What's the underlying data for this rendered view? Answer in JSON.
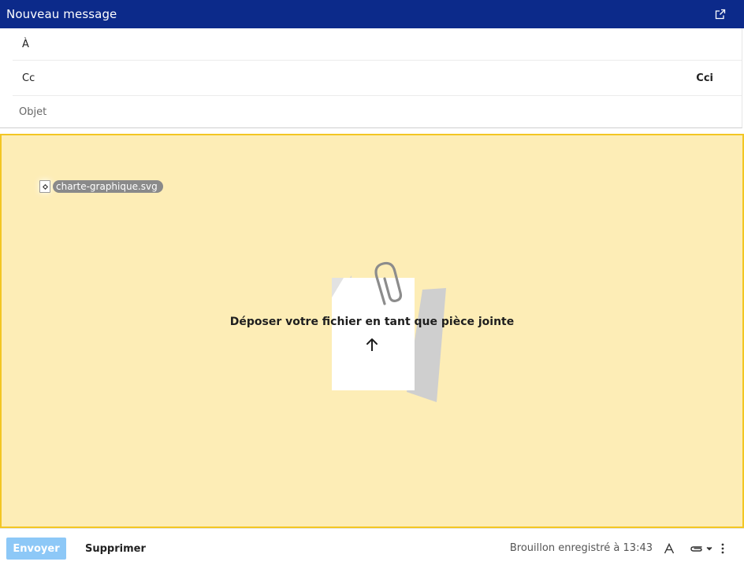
{
  "header": {
    "title": "Nouveau message",
    "popout_icon": "external-window-icon"
  },
  "fields": {
    "to_label": "À",
    "cc_label": "Cc",
    "bcc_label": "Cci",
    "subject_label": "Objet"
  },
  "dropzone": {
    "dragged_file_name": "charte-graphique.svg",
    "message": "Déposer votre fichier en tant que pièce jointe",
    "background_color": "#fdedb6",
    "border_color": "#f3c623"
  },
  "footer": {
    "send_label": "Envoyer",
    "delete_label": "Supprimer",
    "status": "Brouillon enregistré à 13:43",
    "format_icon": "text-format-icon",
    "attach_icon": "paperclip-icon",
    "more_icon": "more-vertical-icon"
  },
  "colors": {
    "header_bg": "#0c2a8a",
    "send_button_bg": "#8dc8f7"
  }
}
